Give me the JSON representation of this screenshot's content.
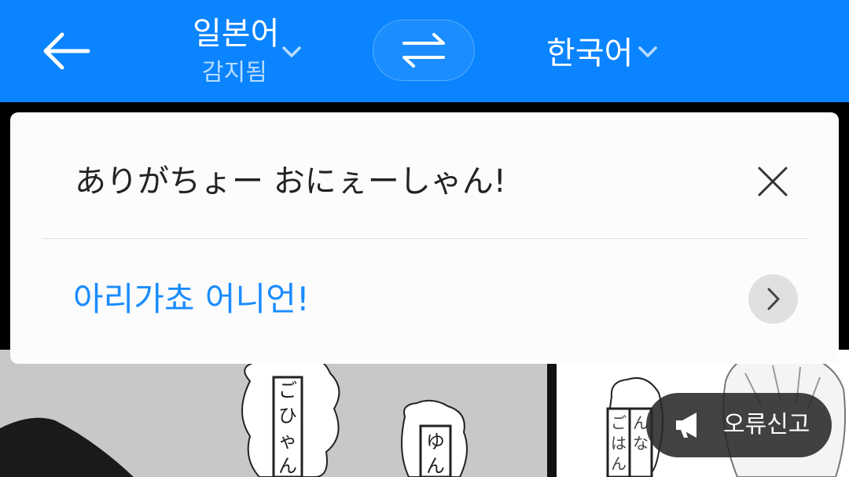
{
  "header": {
    "source_lang": "일본어",
    "source_detected": "감지됨",
    "target_lang": "한국어",
    "colors": {
      "bar": "#0a84ff",
      "accent": "#1a8cff"
    }
  },
  "card": {
    "source_text": "ありがちょー おにぇーしゃん!",
    "translated_text": "아리가쵸 어니언!"
  },
  "report_button": {
    "label": "오류신고"
  },
  "icons": {
    "back": "arrow-left-icon",
    "source_dropdown": "chevron-down-icon",
    "swap": "swap-arrows-icon",
    "target_dropdown": "chevron-down-icon",
    "clear": "close-icon",
    "next": "chevron-right-icon",
    "report": "megaphone-icon"
  }
}
